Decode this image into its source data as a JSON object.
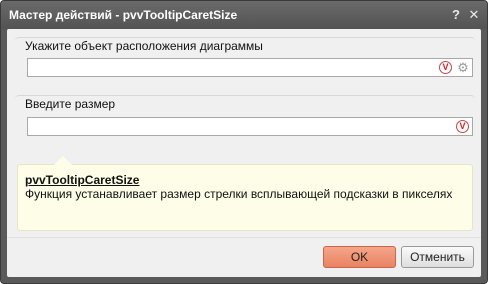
{
  "window": {
    "title": "Мастер действий - pvvTooltipCaretSize",
    "help_label": "?",
    "close_label": "✕"
  },
  "group1": {
    "label": "Укажите объект расположения диаграммы",
    "value": "",
    "v_label": "V",
    "gear_glyph": "⚙"
  },
  "group2": {
    "label": "Введите размер",
    "value": "",
    "v_label": "V"
  },
  "info": {
    "title": "pvvTooltipCaretSize",
    "description": "Функция устанавливает размер стрелки всплывающей подсказки в пикселях"
  },
  "buttons": {
    "ok": "OK",
    "cancel": "Отменить"
  },
  "colors": {
    "ok_button": "#f09273",
    "info_background": "#fdfde8",
    "titlebar": "#5f5f5f"
  }
}
